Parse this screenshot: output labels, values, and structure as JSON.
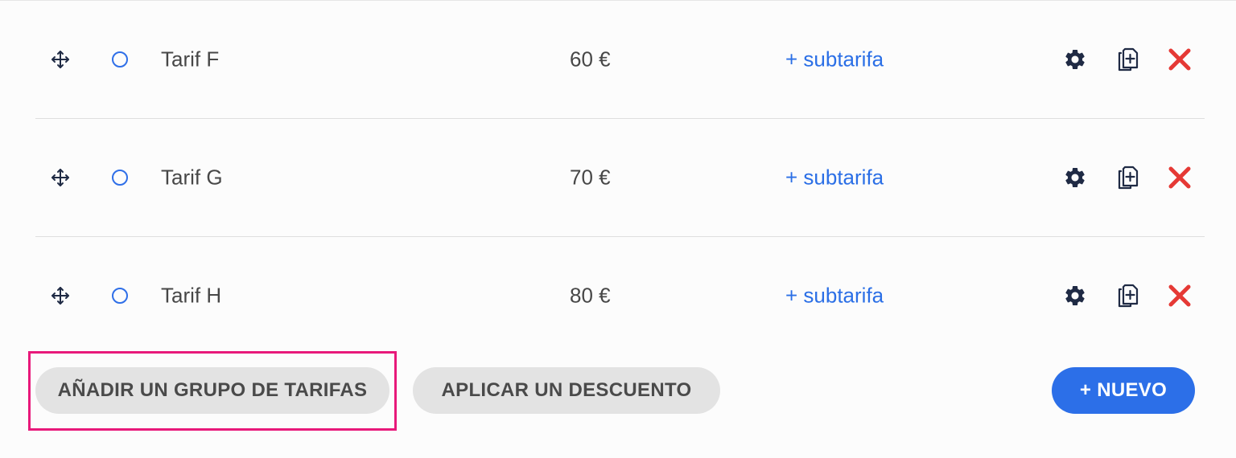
{
  "rows": [
    {
      "name": "Tarif F",
      "price": "60 €",
      "subtarifa": "+ subtarifa"
    },
    {
      "name": "Tarif G",
      "price": "70 €",
      "subtarifa": "+ subtarifa"
    },
    {
      "name": "Tarif H",
      "price": "80 €",
      "subtarifa": "+ subtarifa"
    }
  ],
  "footer": {
    "add_group_label": "AÑADIR UN GRUPO DE TARIFAS",
    "discount_label": "APLICAR UN DESCUENTO",
    "new_label": "+ NUEVO"
  },
  "icons": {
    "move": "move-icon",
    "radio": "radio-icon",
    "settings": "gear-icon",
    "duplicate": "duplicate-icon",
    "delete": "close-icon"
  },
  "colors": {
    "accent": "#2c6fe8",
    "link": "#2b6fe6",
    "delete": "#e53935",
    "icon_dark": "#1f2a44",
    "highlight": "#e8197a"
  }
}
